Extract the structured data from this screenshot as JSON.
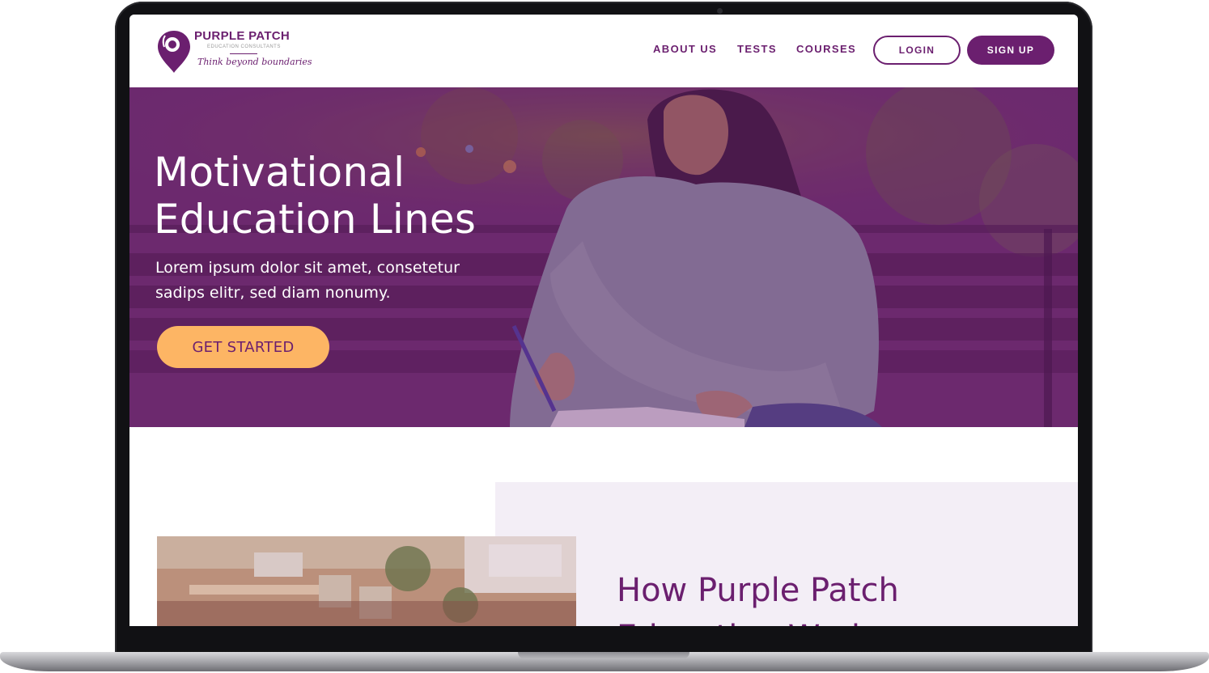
{
  "brand": {
    "name": "PURPLE PATCH",
    "subtitle": "EDUCATION CONSULTANTS",
    "tagline": "Think beyond boundaries",
    "color": "#6b1f6f"
  },
  "nav": {
    "items": [
      {
        "label": "ABOUT US"
      },
      {
        "label": "TESTS"
      },
      {
        "label": "COURSES"
      }
    ],
    "login_label": "LOGIN",
    "signup_label": "SIGN UP"
  },
  "hero": {
    "title_line1": "Motivational",
    "title_line2": "Education Lines",
    "text": "Lorem ipsum dolor sit amet, consetetur sadips elitr, sed diam nonumy.",
    "cta_label": "GET STARTED",
    "cta_color": "#fdb564"
  },
  "how": {
    "title_line1": "How Purple Patch",
    "title_line2": "Education Works"
  },
  "colors": {
    "purple": "#6b1f6f",
    "panel": "#f3eef6"
  }
}
